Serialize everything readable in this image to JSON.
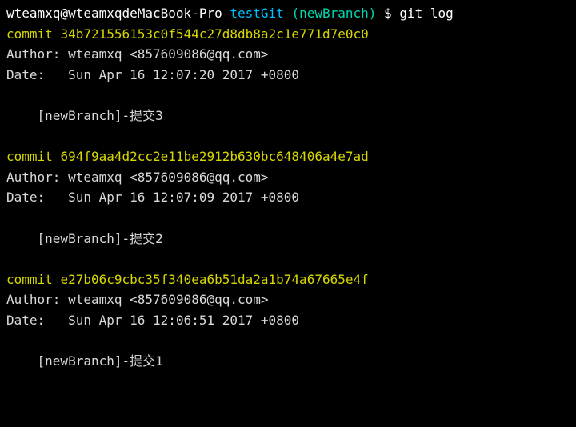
{
  "prompt": {
    "user_host": "wteamxq@wteamxqdeMacBook-Pro",
    "directory": "testGit",
    "branch": "(newBranch)",
    "dollar": "$",
    "command": "git log"
  },
  "commits": [
    {
      "commit_label": "commit",
      "hash": "34b721556153c0f544c27d8db8a2c1e771d7e0c0",
      "author_label": "Author:",
      "author": "wteamxq <857609086@qq.com>",
      "date_label": "Date:",
      "date": "Sun Apr 16 12:07:20 2017 +0800",
      "message": "[newBranch]-提交3"
    },
    {
      "commit_label": "commit",
      "hash": "694f9aa4d2cc2e11be2912b630bc648406a4e7ad",
      "author_label": "Author:",
      "author": "wteamxq <857609086@qq.com>",
      "date_label": "Date:",
      "date": "Sun Apr 16 12:07:09 2017 +0800",
      "message": "[newBranch]-提交2"
    },
    {
      "commit_label": "commit",
      "hash": "e27b06c9cbc35f340ea6b51da2a1b74a67665e4f",
      "author_label": "Author:",
      "author": "wteamxq <857609086@qq.com>",
      "date_label": "Date:",
      "date": "Sun Apr 16 12:06:51 2017 +0800",
      "message": "[newBranch]-提交1"
    }
  ]
}
